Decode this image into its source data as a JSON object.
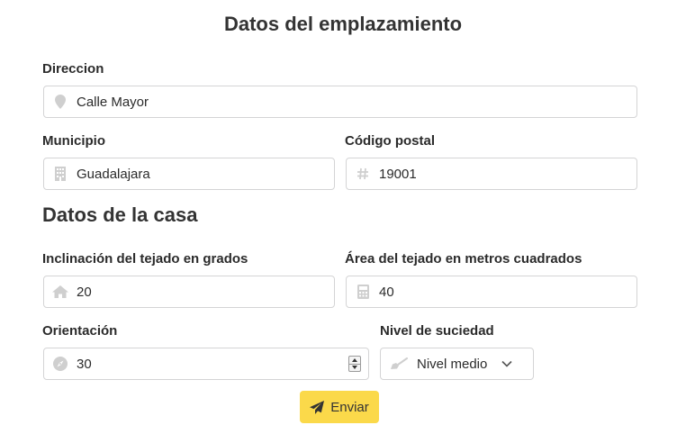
{
  "title": "Datos del emplazamiento",
  "location": {
    "address": {
      "label": "Direccion",
      "value": "Calle Mayor",
      "icon": "map-pin-icon"
    },
    "municipality": {
      "label": "Municipio",
      "value": "Guadalajara",
      "icon": "building-icon"
    },
    "postal_code": {
      "label": "Código postal",
      "value": "19001",
      "icon": "hash-icon"
    }
  },
  "house_section_title": "Datos de la casa",
  "house": {
    "roof_slope": {
      "label": "Inclinación del tejado en grados",
      "value": "20",
      "icon": "home-icon"
    },
    "roof_area": {
      "label": "Área del tejado en metros cuadrados",
      "value": "40",
      "icon": "calculator-icon"
    },
    "orientation": {
      "label": "Orientación",
      "value": "30",
      "icon": "compass-icon"
    },
    "dirt_level": {
      "label": "Nivel de suciedad",
      "value": "Nivel medio",
      "icon": "broom-icon"
    }
  },
  "submit": {
    "label": "Enviar",
    "icon": "paper-plane-icon"
  },
  "colors": {
    "accent": "#fbd94a",
    "icon": "#cfcfcf",
    "border": "#d4d4d5"
  }
}
